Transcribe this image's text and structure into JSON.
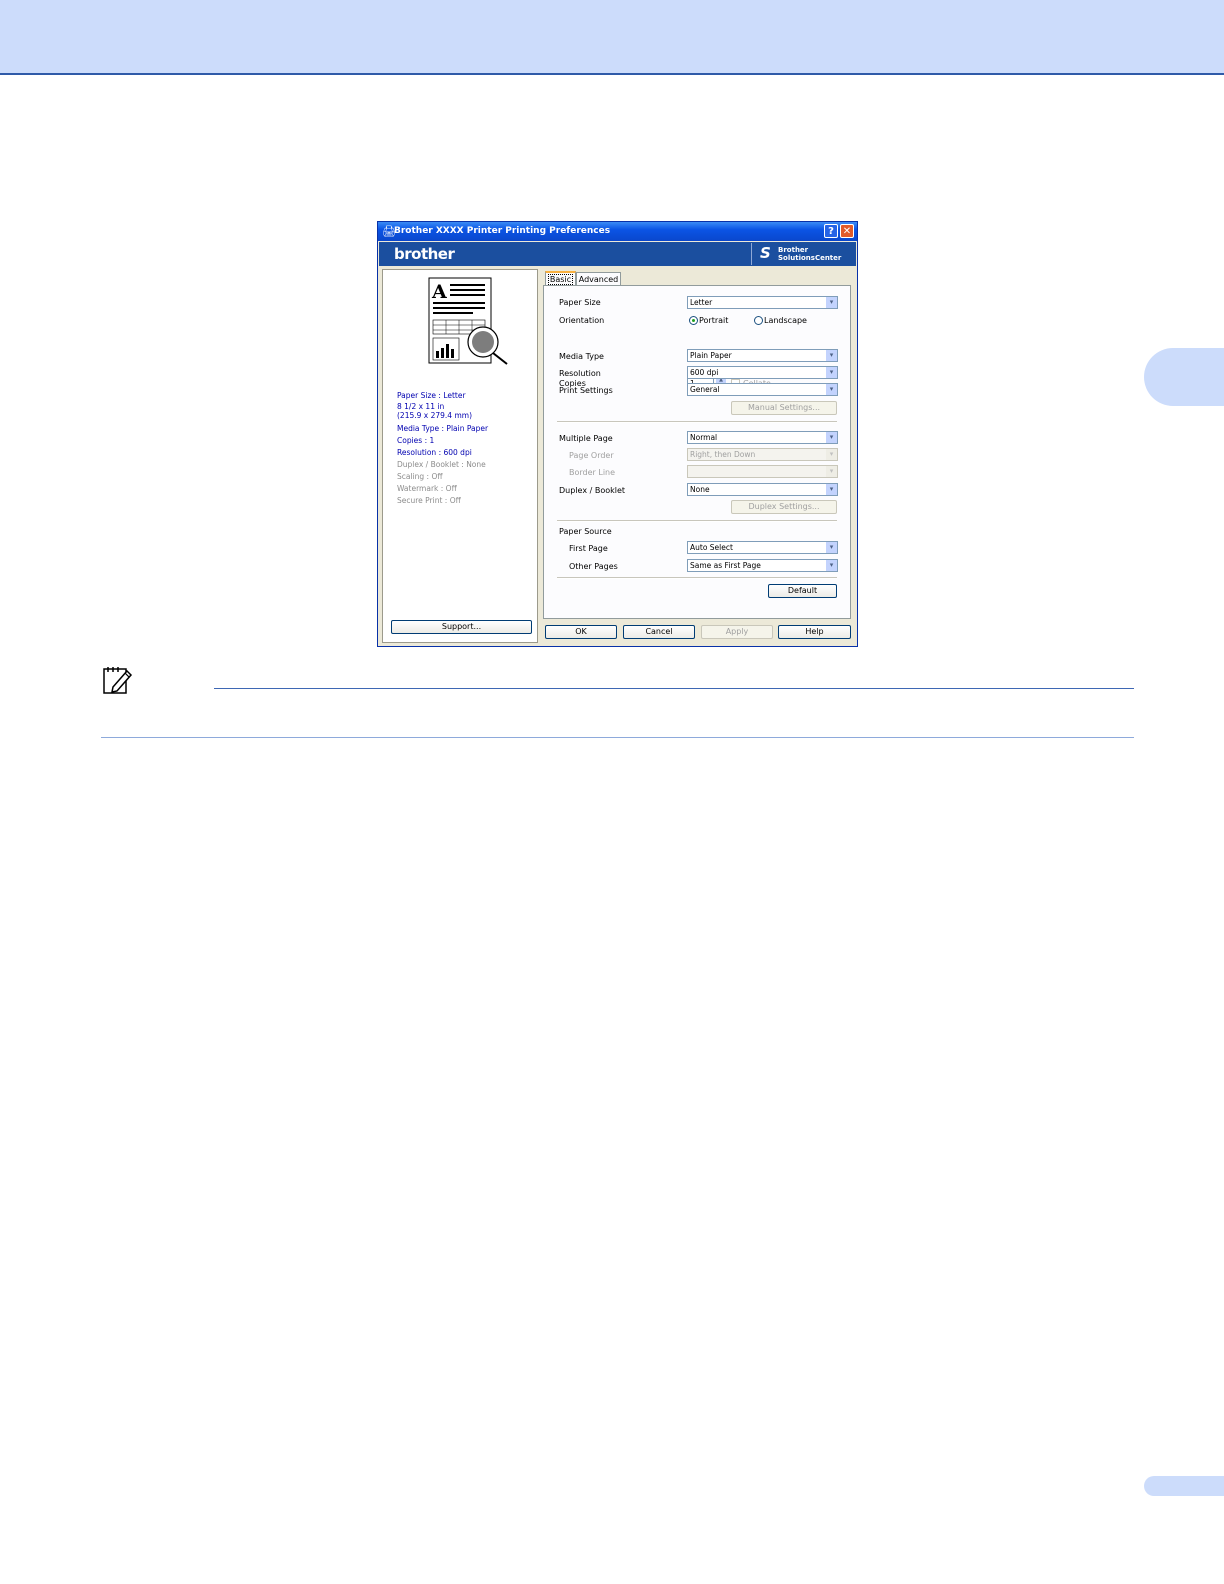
{
  "dialog": {
    "title": "Brother  XXXX  Printer Printing Preferences",
    "help_btn": "?",
    "close_btn": "✕",
    "brand": "brother",
    "solutions_center": [
      "Brother",
      "SolutionsCenter"
    ]
  },
  "summary": {
    "lines": [
      "Paper Size : Letter",
      "8 1/2 x 11 in",
      "(215.9 x 279.4 mm)",
      "Media Type : Plain Paper",
      "Copies : 1",
      "Resolution : 600 dpi",
      "Duplex / Booklet : None",
      "Scaling : Off",
      "Watermark : Off",
      "Secure Print : Off"
    ],
    "support_button": "Support..."
  },
  "tabs": [
    "Basic",
    "Advanced"
  ],
  "basic": {
    "paper_size_label": "Paper Size",
    "paper_size_value": "Letter",
    "orientation_label": "Orientation",
    "portrait": "Portrait",
    "landscape": "Landscape",
    "copies_label": "Copies",
    "copies_value": "1",
    "collate": "Collate",
    "media_type_label": "Media Type",
    "media_type_value": "Plain Paper",
    "resolution_label": "Resolution",
    "resolution_value": "600 dpi",
    "print_settings_label": "Print Settings",
    "print_settings_value": "General",
    "manual_settings": "Manual Settings...",
    "multiple_page_label": "Multiple Page",
    "multiple_page_value": "Normal",
    "page_order_label": "Page Order",
    "page_order_value": "Right, then Down",
    "border_line_label": "Border Line",
    "duplex_label": "Duplex / Booklet",
    "duplex_value": "None",
    "duplex_settings": "Duplex Settings...",
    "paper_source_label": "Paper Source",
    "first_page_label": "First Page",
    "first_page_value": "Auto Select",
    "other_pages_label": "Other Pages",
    "other_pages_value": "Same as First Page",
    "default_button": "Default"
  },
  "footer": {
    "ok": "OK",
    "cancel": "Cancel",
    "apply": "Apply",
    "help": "Help"
  },
  "icons": {
    "dropdown_arrow": "▾",
    "spin_up": "▲",
    "spin_down": "▼"
  }
}
